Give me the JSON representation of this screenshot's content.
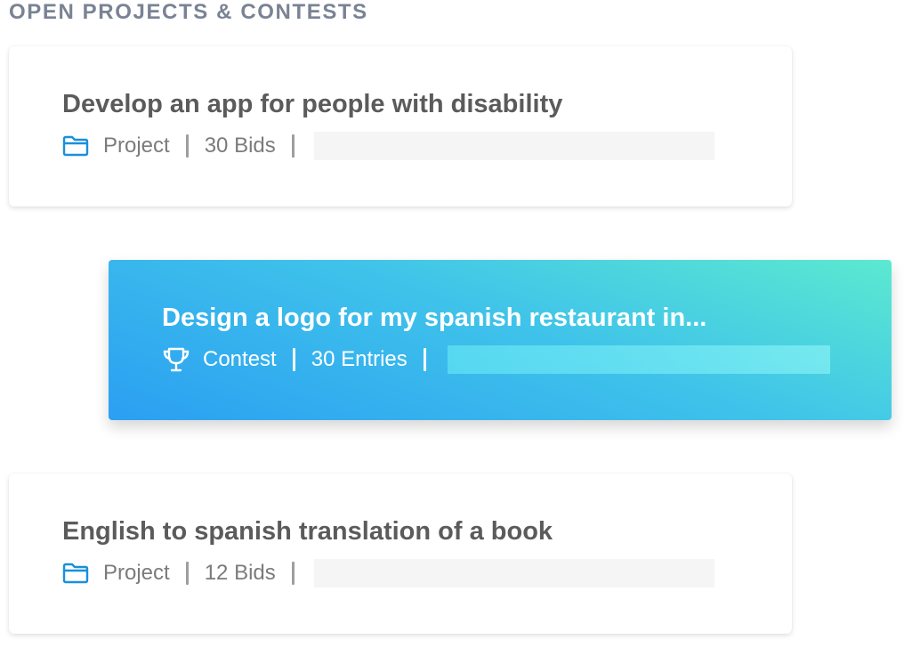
{
  "section": {
    "title": "OPEN PROJECTS & CONTESTS"
  },
  "cards": [
    {
      "title": "Develop an app for people with disability",
      "type_label": "Project",
      "type_icon": "folder-icon",
      "count_label": "30 Bids",
      "highlighted": false
    },
    {
      "title": "Design a logo for my spanish restaurant in...",
      "type_label": "Contest",
      "type_icon": "trophy-icon",
      "count_label": "30 Entries",
      "highlighted": true
    },
    {
      "title": "English to spanish translation of a book",
      "type_label": "Project",
      "type_icon": "folder-icon",
      "count_label": "12 Bids",
      "highlighted": false
    }
  ],
  "colors": {
    "section_title": "#7a8394",
    "card_title": "#5b5b5b",
    "meta_text": "#7b7b7b",
    "folder_icon": "#1a8fdc",
    "highlight_gradient_start": "#2b9ff2",
    "highlight_gradient_end": "#5ce9d0"
  }
}
